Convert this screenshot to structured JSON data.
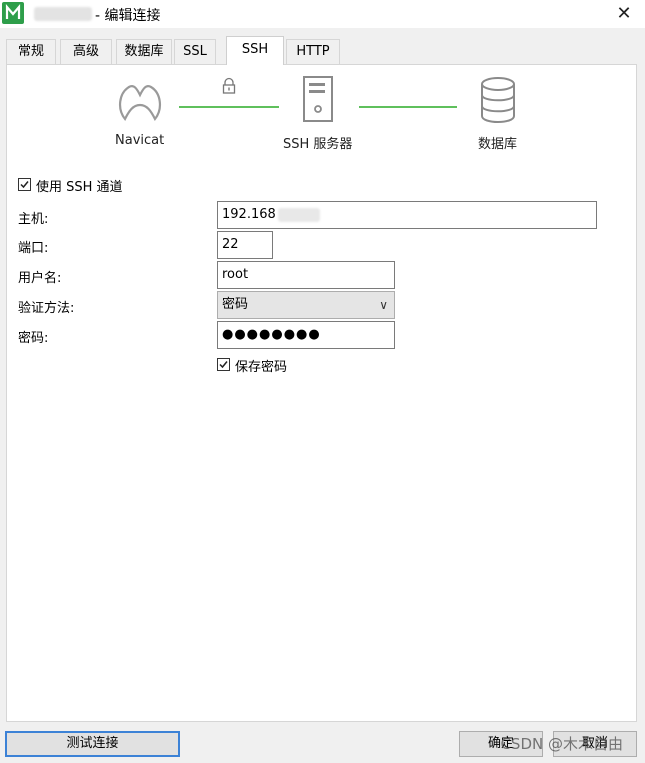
{
  "window": {
    "title": "- 编辑连接",
    "close_icon": "close-icon"
  },
  "tabs": [
    {
      "label": "常规"
    },
    {
      "label": "高级"
    },
    {
      "label": "数据库"
    },
    {
      "label": "SSL"
    },
    {
      "label": "SSH",
      "active": true
    },
    {
      "label": "HTTP"
    }
  ],
  "diagram": {
    "client_label": "Navicat",
    "server_label": "SSH 服务器",
    "db_label": "数据库",
    "line_color": "#5fc05c"
  },
  "ssh": {
    "use_tunnel_label": "使用 SSH 通道",
    "use_tunnel_checked": true,
    "host_label": "主机:",
    "host_value": "192.168",
    "port_label": "端口:",
    "port_value": "22",
    "user_label": "用户名:",
    "user_value": "root",
    "auth_label": "验证方法:",
    "auth_value": "密码",
    "password_label": "密码:",
    "password_value": "●●●●●●●●",
    "save_password_label": "保存密码",
    "save_password_checked": true
  },
  "footer": {
    "test_button": "测试连接",
    "ok_button": "确定",
    "cancel_button": "取消",
    "watermark": "CSDN @木木自由"
  },
  "colors": {
    "accent": "#3c82d6",
    "panel": "#ffffff",
    "background": "#f0f0f0",
    "app_icon": "#2e9e4a"
  }
}
